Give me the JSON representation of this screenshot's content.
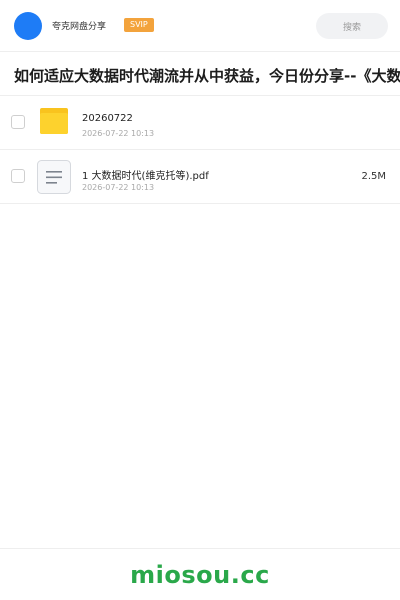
{
  "header": {
    "site_name": "夸克网盘分享",
    "badge": "SVIP",
    "search_label": "搜索",
    "avatar_color": "#1e7cf6",
    "badge_color": "#f3a33c"
  },
  "title": "如何适应大数据时代潮流并从中获益，今日份分享--《大数",
  "files": [
    {
      "name": "20260722",
      "date": "2026-07-22 10:13",
      "type": "folder",
      "icon": "folder-icon",
      "size": ""
    },
    {
      "name": "1  大数据时代(维克托等).pdf",
      "date": "2026-07-22 10:13",
      "type": "pdf",
      "icon": "document-icon",
      "size": "2.5M"
    }
  ],
  "footer": {
    "logo_text": "miosou.cc",
    "logo_color": "#2aa84a"
  }
}
